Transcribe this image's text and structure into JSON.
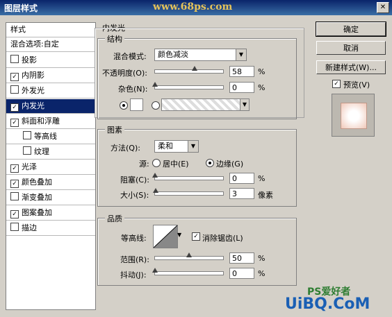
{
  "window": {
    "title": "图层样式",
    "watermark": "www.68ps.com",
    "close_glyph": "✕"
  },
  "styles_panel": {
    "header": "样式",
    "blend_options": "混合选项:自定",
    "items": [
      {
        "label": "投影",
        "checked": false,
        "sub": false
      },
      {
        "label": "内阴影",
        "checked": true,
        "sub": false
      },
      {
        "label": "外发光",
        "checked": false,
        "sub": false
      },
      {
        "label": "内发光",
        "checked": true,
        "sub": false,
        "selected": true
      },
      {
        "label": "斜面和浮雕",
        "checked": true,
        "sub": false
      },
      {
        "label": "等高线",
        "checked": false,
        "sub": true
      },
      {
        "label": "纹理",
        "checked": false,
        "sub": true
      },
      {
        "label": "光泽",
        "checked": true,
        "sub": false
      },
      {
        "label": "颜色叠加",
        "checked": true,
        "sub": false
      },
      {
        "label": "渐变叠加",
        "checked": false,
        "sub": false
      },
      {
        "label": "图案叠加",
        "checked": true,
        "sub": false
      },
      {
        "label": "描边",
        "checked": false,
        "sub": false
      }
    ]
  },
  "inner_glow": {
    "title": "内发光",
    "structure": {
      "title": "结构",
      "blend_mode_label": "混合模式:",
      "blend_mode_value": "颜色减淡",
      "opacity_label": "不透明度(O):",
      "opacity_value": "58",
      "opacity_level": 0.58,
      "noise_label": "杂色(N):",
      "noise_value": "0",
      "noise_level": 0,
      "percent": "%"
    },
    "elements": {
      "title": "图素",
      "method_label": "方法(Q):",
      "method_value": "柔和",
      "source_label": "源:",
      "source_center": "居中(E)",
      "source_edge": "边缘(G)",
      "choke_label": "阻塞(C):",
      "choke_value": "0",
      "choke_level": 0,
      "size_label": "大小(S):",
      "size_value": "3",
      "size_unit": "像素",
      "size_level": 0.012,
      "percent": "%"
    },
    "quality": {
      "title": "品质",
      "contour_label": "等高线:",
      "antialias_label": "消除锯齿(L)",
      "range_label": "范围(R):",
      "range_value": "50",
      "range_level": 0.5,
      "jitter_label": "抖动(J):",
      "jitter_value": "0",
      "jitter_level": 0,
      "percent": "%"
    }
  },
  "buttons": {
    "ok": "确定",
    "cancel": "取消",
    "new_style": "新建样式(W)...",
    "preview": "预览(V)"
  },
  "branding": {
    "logo_top": "PS爱好者",
    "logo_bottom": "UiBQ.CoM"
  }
}
